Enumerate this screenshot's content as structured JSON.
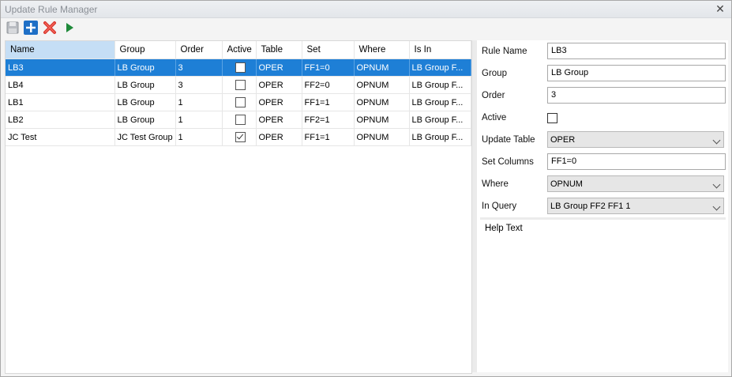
{
  "window": {
    "title": "Update Rule Manager"
  },
  "toolbar": {
    "buttons": [
      {
        "name": "save",
        "icon": "save-icon"
      },
      {
        "name": "add",
        "icon": "plus-icon"
      },
      {
        "name": "delete",
        "icon": "delete-x-icon"
      },
      {
        "name": "run",
        "icon": "play-icon"
      }
    ]
  },
  "grid": {
    "columns": [
      "Name",
      "Group",
      "Order",
      "Active",
      "Table",
      "Set",
      "Where",
      "Is In"
    ],
    "rows": [
      {
        "name": "LB3",
        "group": "LB Group",
        "order": "3",
        "active": false,
        "table": "OPER",
        "set": "FF1=0",
        "where": "OPNUM",
        "is_in": "LB Group F...",
        "selected": true
      },
      {
        "name": "LB4",
        "group": "LB Group",
        "order": "3",
        "active": false,
        "table": "OPER",
        "set": "FF2=0",
        "where": "OPNUM",
        "is_in": "LB Group F...",
        "selected": false
      },
      {
        "name": "LB1",
        "group": "LB Group",
        "order": "1",
        "active": false,
        "table": "OPER",
        "set": "FF1=1",
        "where": "OPNUM",
        "is_in": "LB Group F...",
        "selected": false
      },
      {
        "name": "LB2",
        "group": "LB Group",
        "order": "1",
        "active": false,
        "table": "OPER",
        "set": "FF2=1",
        "where": "OPNUM",
        "is_in": "LB Group F...",
        "selected": false
      },
      {
        "name": "JC Test",
        "group": "JC Test Group",
        "order": "1",
        "active": true,
        "table": "OPER",
        "set": "FF1=1",
        "where": "OPNUM",
        "is_in": "LB Group F...",
        "selected": false
      }
    ]
  },
  "properties": {
    "rule_name": {
      "label": "Rule Name",
      "value": "LB3"
    },
    "group": {
      "label": "Group",
      "value": "LB Group"
    },
    "order": {
      "label": "Order",
      "value": "3"
    },
    "active": {
      "label": "Active",
      "checked": false
    },
    "update_table": {
      "label": "Update Table",
      "value": "OPER"
    },
    "set_columns": {
      "label": "Set Columns",
      "value": "FF1=0"
    },
    "where": {
      "label": "Where",
      "value": "OPNUM"
    },
    "in_query": {
      "label": "In Query",
      "value": "LB Group FF2 FF1 1"
    }
  },
  "help": {
    "text": "Help Text"
  },
  "colors": {
    "selection": "#1e7fd6",
    "header_sorted": "#c5def5",
    "add_button": "#1e6fc6",
    "delete_button": "#d9342b",
    "run_button": "#1f8a3a"
  }
}
